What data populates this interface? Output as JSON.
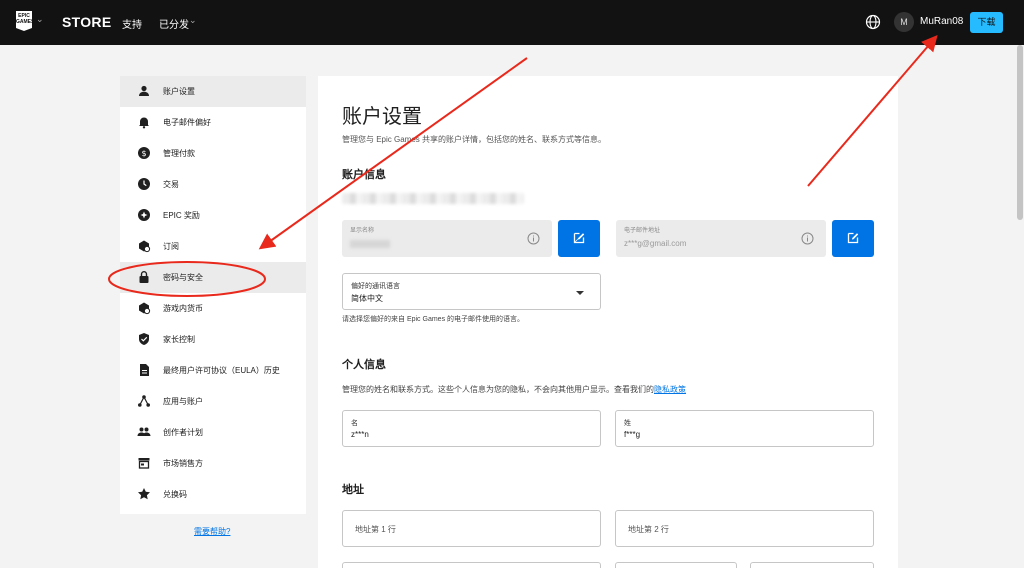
{
  "topbar": {
    "logo_text": "EPIC GAMES",
    "store": "STORE",
    "nav_support": "支持",
    "nav_distribution": "已分发",
    "avatar_initial": "M",
    "username": "MuRan08",
    "download": "下载"
  },
  "sidebar": {
    "items": [
      {
        "label": "账户设置",
        "icon": "person-icon"
      },
      {
        "label": "电子邮件偏好",
        "icon": "bell-icon"
      },
      {
        "label": "管理付款",
        "icon": "dollar-icon"
      },
      {
        "label": "交易",
        "icon": "clock-icon"
      },
      {
        "label": "EPIC 奖励",
        "icon": "rewards-icon"
      },
      {
        "label": "订阅",
        "icon": "subscription-icon"
      },
      {
        "label": "密码与安全",
        "icon": "lock-icon"
      },
      {
        "label": "游戏内货币",
        "icon": "currency-icon"
      },
      {
        "label": "家长控制",
        "icon": "shield-icon"
      },
      {
        "label": "最终用户许可协议（EULA）历史",
        "icon": "document-icon"
      },
      {
        "label": "应用与账户",
        "icon": "apps-icon"
      },
      {
        "label": "创作者计划",
        "icon": "people-icon"
      },
      {
        "label": "市场销售方",
        "icon": "storefront-icon"
      },
      {
        "label": "兑换码",
        "icon": "star-icon"
      }
    ],
    "help": "需要帮助?"
  },
  "main": {
    "title": "账户设置",
    "description": "管理您与 Epic Games 共享的账户详情，包括您的姓名、联系方式等信息。",
    "account_info": {
      "heading": "账户信息",
      "display_name_label": "显示名称",
      "email_label": "电子邮件地址",
      "email_value": "z***g@gmail.com",
      "language_label": "偏好的通讯语言",
      "language_value": "简体中文",
      "language_note": "请选择您偏好的来自 Epic Games 的电子邮件使用的语言。"
    },
    "personal_info": {
      "heading": "个人信息",
      "description": "管理您的姓名和联系方式。这些个人信息为您的隐私，不会向其他用户显示。查看我们的",
      "privacy_link": "隐私政策",
      "first_name_label": "名",
      "first_name_value": "z***n",
      "last_name_label": "姓",
      "last_name_value": "f***g"
    },
    "address": {
      "heading": "地址",
      "line1_placeholder": "地址第 1 行",
      "line2_placeholder": "地址第 2 行"
    }
  },
  "colors": {
    "topbar": "#121212",
    "accent_blue": "#0074e4",
    "download_button": "#26bbff",
    "annotation_red": "#e8291c"
  }
}
